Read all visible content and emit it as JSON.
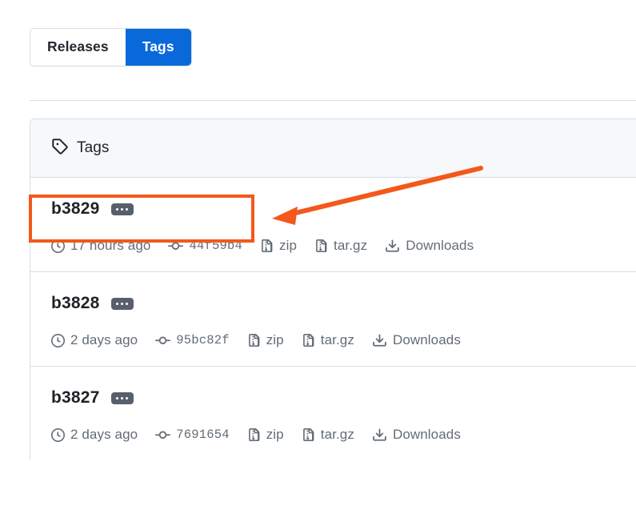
{
  "tabs": {
    "items": [
      {
        "label": "Releases",
        "active": false,
        "name": "tab-releases"
      },
      {
        "label": "Tags",
        "active": true,
        "name": "tab-tags"
      }
    ],
    "active_color": "#0969da"
  },
  "card": {
    "header": {
      "icon": "tag-icon",
      "label": "Tags"
    },
    "rows": [
      {
        "tag_name": "b3829",
        "badge_icon": "kebab-ellipsis-icon",
        "meta": {
          "time_icon": "clock-icon",
          "time": "17 hours ago",
          "commit_icon": "git-commit-icon",
          "commit": "44f59b4",
          "zip_icon": "file-zip-icon",
          "zip": "zip",
          "targz_icon": "file-zip-icon",
          "targz": "tar.gz",
          "downloads_icon": "download-icon",
          "downloads": "Downloads"
        }
      },
      {
        "tag_name": "b3828",
        "badge_icon": "kebab-ellipsis-icon",
        "meta": {
          "time_icon": "clock-icon",
          "time": "2 days ago",
          "commit_icon": "git-commit-icon",
          "commit": "95bc82f",
          "zip_icon": "file-zip-icon",
          "zip": "zip",
          "targz_icon": "file-zip-icon",
          "targz": "tar.gz",
          "downloads_icon": "download-icon",
          "downloads": "Downloads"
        }
      },
      {
        "tag_name": "b3827",
        "badge_icon": "kebab-ellipsis-icon",
        "meta": {
          "time_icon": "clock-icon",
          "time": "2 days ago",
          "commit_icon": "git-commit-icon",
          "commit": "7691654",
          "zip_icon": "file-zip-icon",
          "zip": "zip",
          "targz_icon": "file-zip-icon",
          "targz": "tar.gz",
          "downloads_icon": "download-icon",
          "downloads": "Downloads"
        }
      }
    ]
  },
  "annotation": {
    "highlight_color": "#f4581a",
    "arrow_color": "#f4581a",
    "target": "b3829"
  }
}
